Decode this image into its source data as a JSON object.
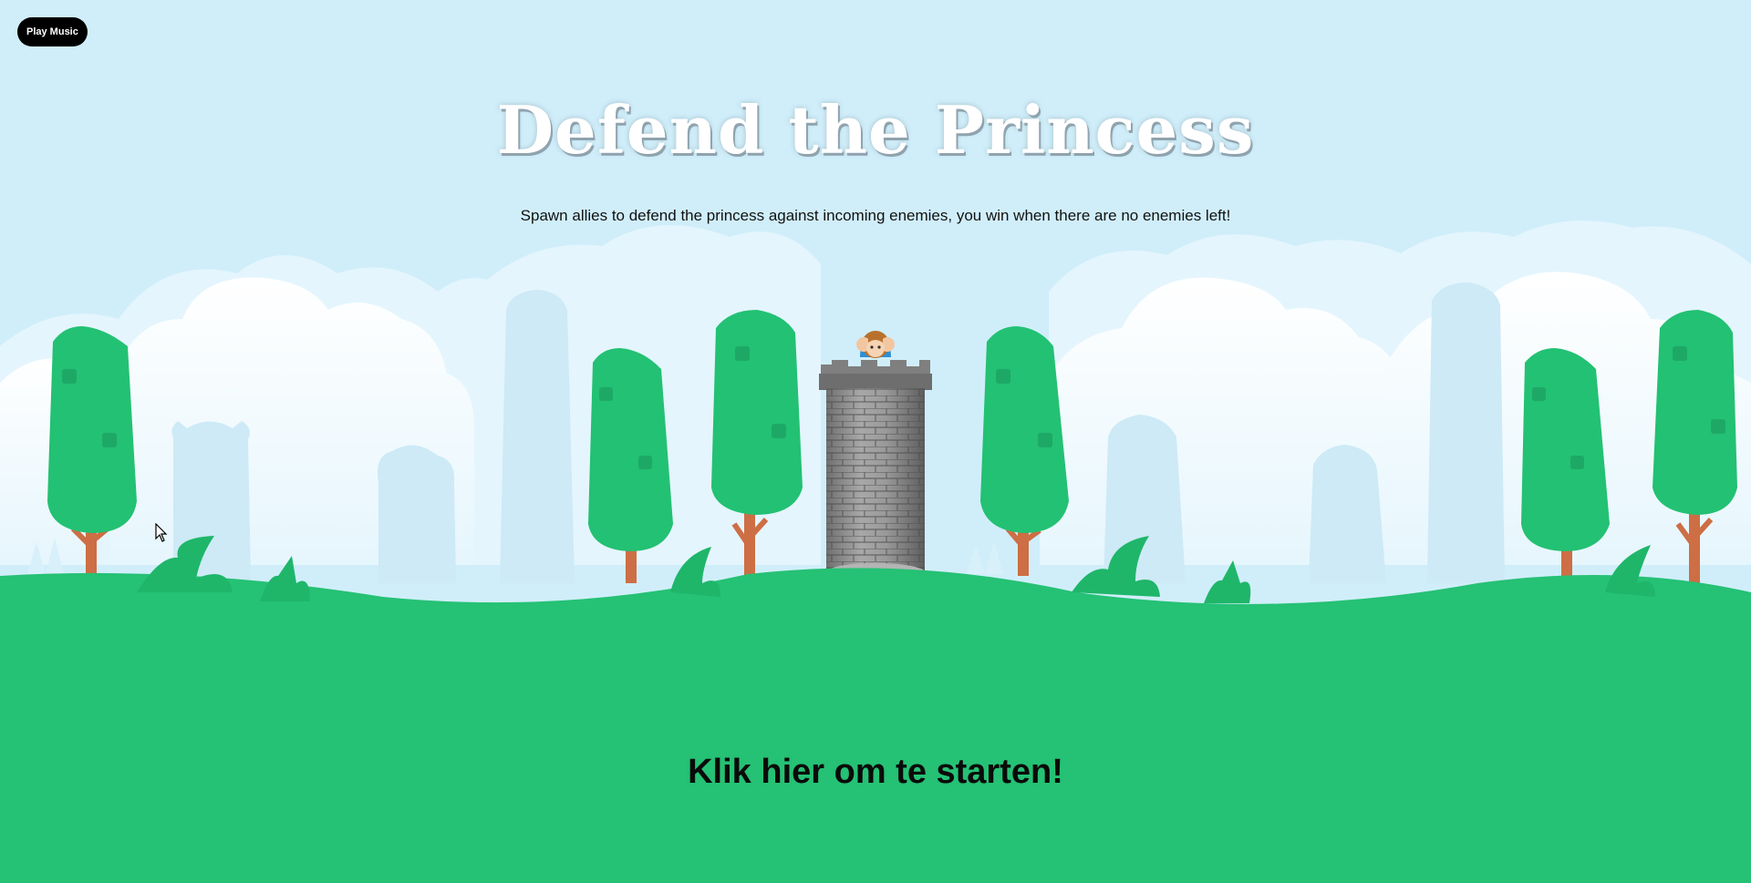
{
  "music_button": {
    "label": "Play Music"
  },
  "header": {
    "title": "Defend the Princess",
    "subtitle": "Spawn allies to defend the princess against incoming enemies, you win when there are no enemies left!"
  },
  "start": {
    "label": "Klik hier om te starten!"
  },
  "colors": {
    "sky": "#d0eefa",
    "ground": "#25c174",
    "tree_leaves": "#23c173",
    "tree_trunk": "#cd6e45",
    "tower_stone": "#8d8d8d",
    "princess_dress": "#2e8fd6",
    "princess_hair": "#b8712c"
  },
  "icons": {
    "cursor": "arrow-cursor-icon",
    "princess": "princess-icon",
    "tower": "stone-tower-icon",
    "tree": "tree-icon",
    "bush": "grass-bush-icon"
  }
}
